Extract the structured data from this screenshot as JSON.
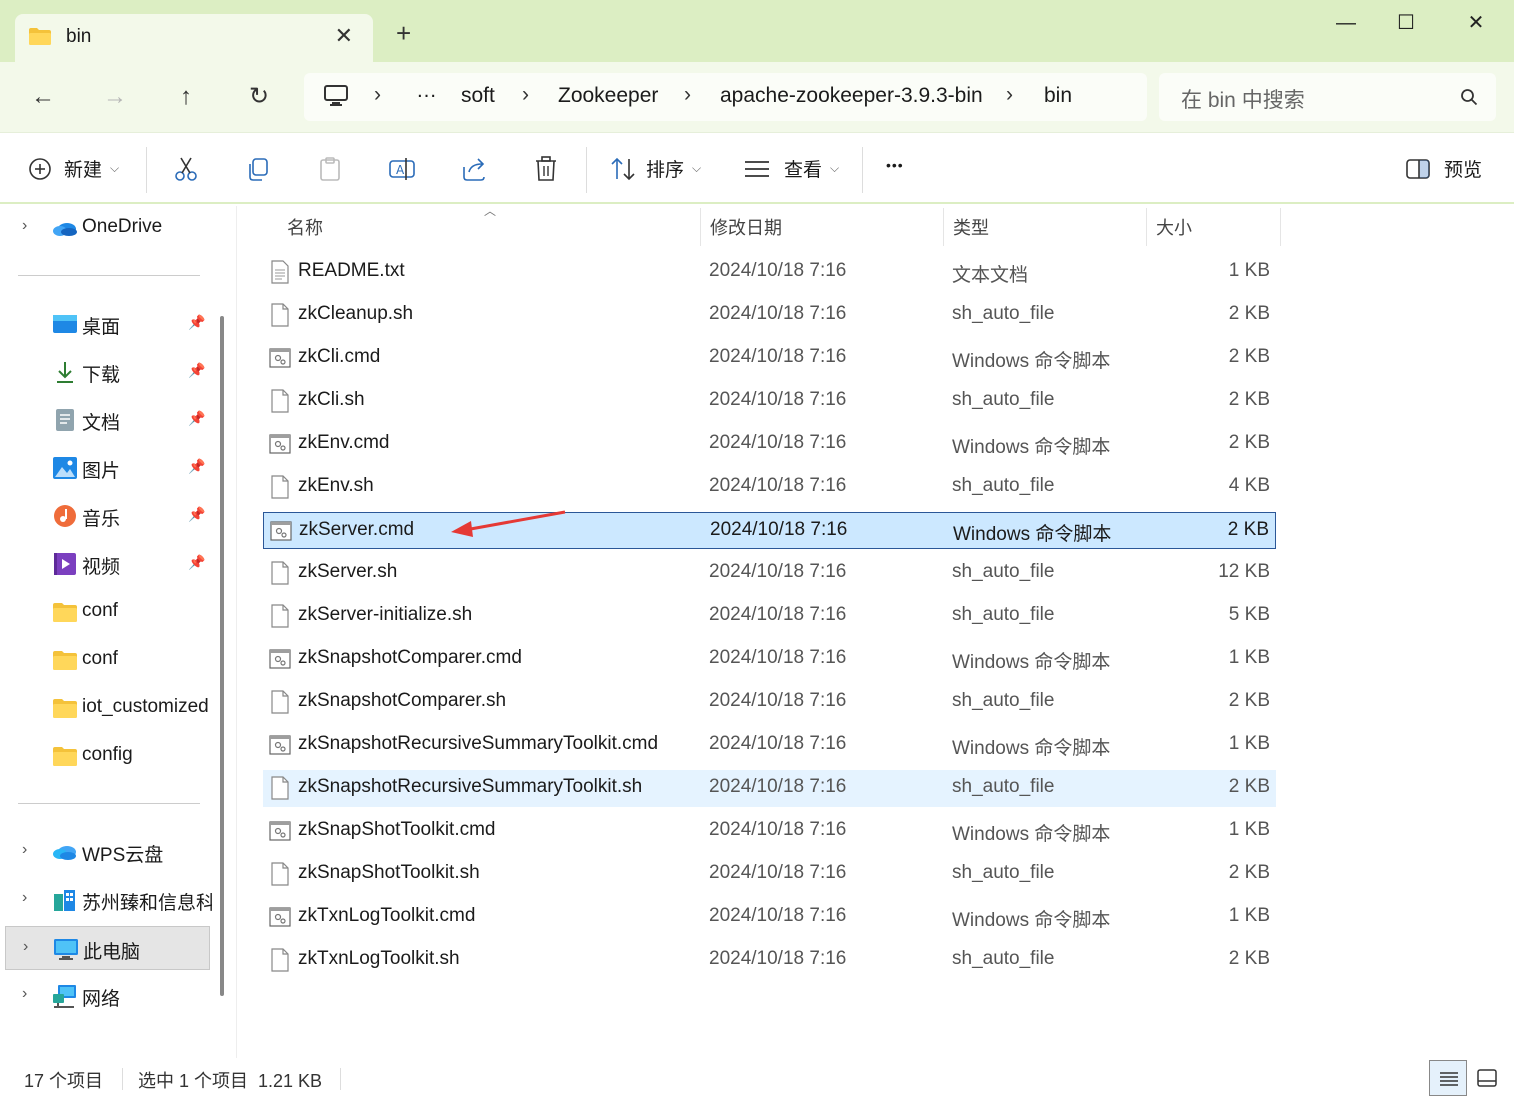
{
  "window": {
    "tab_title": "bin",
    "tab_close": "✕",
    "new_tab": "+",
    "minimize": "—",
    "maximize": "☐",
    "close": "✕"
  },
  "nav": {
    "back": "←",
    "forward": "→",
    "up": "↑",
    "refresh": "↻",
    "breadcrumbs": [
      "…",
      "soft",
      "Zookeeper",
      "apache-zookeeper-3.9.3-bin",
      "bin"
    ],
    "separator": "›",
    "search_placeholder": "在 bin 中搜索"
  },
  "toolbar": {
    "new_label": "新建",
    "sort_label": "排序",
    "view_label": "查看",
    "more_label": "•••",
    "preview_label": "预览"
  },
  "sidebar": {
    "top": [
      {
        "label": "OneDrive",
        "icon": "onedrive-icon"
      }
    ],
    "quick_access": [
      {
        "label": "桌面",
        "icon": "desktop-icon",
        "pinned": true
      },
      {
        "label": "下载",
        "icon": "download-icon",
        "pinned": true
      },
      {
        "label": "文档",
        "icon": "documents-icon",
        "pinned": true
      },
      {
        "label": "图片",
        "icon": "pictures-icon",
        "pinned": true
      },
      {
        "label": "音乐",
        "icon": "music-icon",
        "pinned": true
      },
      {
        "label": "视频",
        "icon": "videos-icon",
        "pinned": true
      },
      {
        "label": "conf",
        "icon": "folder-icon",
        "pinned": false
      },
      {
        "label": "conf",
        "icon": "folder-icon",
        "pinned": false
      },
      {
        "label": "iot_customized",
        "icon": "folder-icon",
        "pinned": false
      },
      {
        "label": "config",
        "icon": "folder-icon",
        "pinned": false
      }
    ],
    "locations": [
      {
        "label": "WPS云盘",
        "icon": "cloud-icon"
      },
      {
        "label": "苏州臻和信息科",
        "icon": "org-icon"
      },
      {
        "label": "此电脑",
        "icon": "this-pc-icon",
        "selected": true
      },
      {
        "label": "网络",
        "icon": "network-icon"
      }
    ]
  },
  "columns": {
    "name": "名称",
    "date": "修改日期",
    "type": "类型",
    "size": "大小"
  },
  "files": [
    {
      "name": "README.txt",
      "date": "2024/10/18 7:16",
      "type": "文本文档",
      "size": "1 KB",
      "kind": "txt"
    },
    {
      "name": "zkCleanup.sh",
      "date": "2024/10/18 7:16",
      "type": "sh_auto_file",
      "size": "2 KB",
      "kind": "sh"
    },
    {
      "name": "zkCli.cmd",
      "date": "2024/10/18 7:16",
      "type": "Windows 命令脚本",
      "size": "2 KB",
      "kind": "cmd"
    },
    {
      "name": "zkCli.sh",
      "date": "2024/10/18 7:16",
      "type": "sh_auto_file",
      "size": "2 KB",
      "kind": "sh"
    },
    {
      "name": "zkEnv.cmd",
      "date": "2024/10/18 7:16",
      "type": "Windows 命令脚本",
      "size": "2 KB",
      "kind": "cmd"
    },
    {
      "name": "zkEnv.sh",
      "date": "2024/10/18 7:16",
      "type": "sh_auto_file",
      "size": "4 KB",
      "kind": "sh"
    },
    {
      "name": "zkServer.cmd",
      "date": "2024/10/18 7:16",
      "type": "Windows 命令脚本",
      "size": "2 KB",
      "kind": "cmd",
      "selected": true
    },
    {
      "name": "zkServer.sh",
      "date": "2024/10/18 7:16",
      "type": "sh_auto_file",
      "size": "12 KB",
      "kind": "sh"
    },
    {
      "name": "zkServer-initialize.sh",
      "date": "2024/10/18 7:16",
      "type": "sh_auto_file",
      "size": "5 KB",
      "kind": "sh"
    },
    {
      "name": "zkSnapshotComparer.cmd",
      "date": "2024/10/18 7:16",
      "type": "Windows 命令脚本",
      "size": "1 KB",
      "kind": "cmd"
    },
    {
      "name": "zkSnapshotComparer.sh",
      "date": "2024/10/18 7:16",
      "type": "sh_auto_file",
      "size": "2 KB",
      "kind": "sh"
    },
    {
      "name": "zkSnapshotRecursiveSummaryToolkit.cmd",
      "date": "2024/10/18 7:16",
      "type": "Windows 命令脚本",
      "size": "1 KB",
      "kind": "cmd"
    },
    {
      "name": "zkSnapshotRecursiveSummaryToolkit.sh",
      "date": "2024/10/18 7:16",
      "type": "sh_auto_file",
      "size": "2 KB",
      "kind": "sh",
      "hover": true
    },
    {
      "name": "zkSnapShotToolkit.cmd",
      "date": "2024/10/18 7:16",
      "type": "Windows 命令脚本",
      "size": "1 KB",
      "kind": "cmd"
    },
    {
      "name": "zkSnapShotToolkit.sh",
      "date": "2024/10/18 7:16",
      "type": "sh_auto_file",
      "size": "2 KB",
      "kind": "sh"
    },
    {
      "name": "zkTxnLogToolkit.cmd",
      "date": "2024/10/18 7:16",
      "type": "Windows 命令脚本",
      "size": "1 KB",
      "kind": "cmd"
    },
    {
      "name": "zkTxnLogToolkit.sh",
      "date": "2024/10/18 7:16",
      "type": "sh_auto_file",
      "size": "2 KB",
      "kind": "sh"
    }
  ],
  "status": {
    "item_count": "17 个项目",
    "selection": "选中 1 个项目  1.21 KB"
  },
  "colors": {
    "titlebar": "#dceec3",
    "navrow": "#f3f9ea",
    "selection_bg": "#cce8ff",
    "selection_border": "#2b5797",
    "annotation_arrow": "#e53935"
  }
}
